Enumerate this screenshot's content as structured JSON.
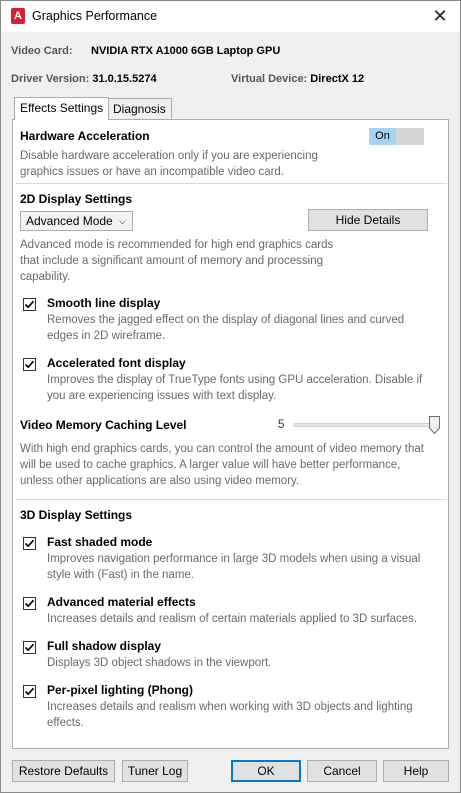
{
  "window": {
    "title": "Graphics Performance",
    "icon": "app-logo-icon"
  },
  "info": {
    "video_card_label": "Video Card:",
    "video_card_value": "NVIDIA RTX A1000 6GB Laptop GPU",
    "driver_label": "Driver Version:",
    "driver_value": "31.0.15.5274",
    "virtual_device_label": "Virtual Device:",
    "virtual_device_value": "DirectX 12"
  },
  "tabs": [
    {
      "label": "Effects Settings",
      "active": true
    },
    {
      "label": "Diagnosis",
      "active": false
    }
  ],
  "hardware": {
    "title": "Hardware Acceleration",
    "toggle_label": "On",
    "desc1": "Disable hardware acceleration only if you are experiencing",
    "desc2": "graphics issues or have an incompatible video card."
  },
  "display2d": {
    "title": "2D Display Settings",
    "mode_value": "Advanced Mode",
    "hide_details": "Hide Details",
    "desc1": "Advanced mode is recommended for high end graphics cards",
    "desc2": "that include a significant amount of memory and processing",
    "desc3": "capability.",
    "options": [
      {
        "label": "Smooth line display",
        "checked": true,
        "desc1": "Removes the jagged effect on the display of diagonal lines and curved",
        "desc2": "edges in 2D wireframe."
      },
      {
        "label": "Accelerated font display",
        "checked": true,
        "desc1": "Improves the display of TrueType fonts using GPU acceleration. Disable if",
        "desc2": "you are experiencing issues with text display."
      }
    ],
    "cache": {
      "title": "Video Memory Caching Level",
      "value": "5",
      "desc1": "With high end graphics cards, you can control the amount of video memory that",
      "desc2": "will be used to cache graphics.  A larger value will have better performance,",
      "desc3": "unless other applications are also using video memory."
    }
  },
  "display3d": {
    "title": "3D Display Settings",
    "options": [
      {
        "label": "Fast shaded mode",
        "checked": true,
        "desc1": "Improves navigation performance in large 3D models when using a visual",
        "desc2": "style with (Fast) in the name."
      },
      {
        "label": "Advanced material effects",
        "checked": true,
        "desc1": "Increases details and realism of certain materials applied to 3D surfaces.",
        "desc2": ""
      },
      {
        "label": "Full shadow display",
        "checked": true,
        "desc1": "Displays 3D object shadows in the viewport.",
        "desc2": ""
      },
      {
        "label": "Per-pixel lighting (Phong)",
        "checked": true,
        "desc1": "Increases details and realism when working with 3D objects and lighting",
        "desc2": "effects."
      }
    ]
  },
  "footer": {
    "restore": "Restore Defaults",
    "tuner": "Tuner Log",
    "ok": "OK",
    "cancel": "Cancel",
    "help": "Help"
  },
  "colors": {
    "accent": "#0078d7",
    "toggle_on": "#a6d3f2",
    "app_icon": "#d51f35"
  }
}
